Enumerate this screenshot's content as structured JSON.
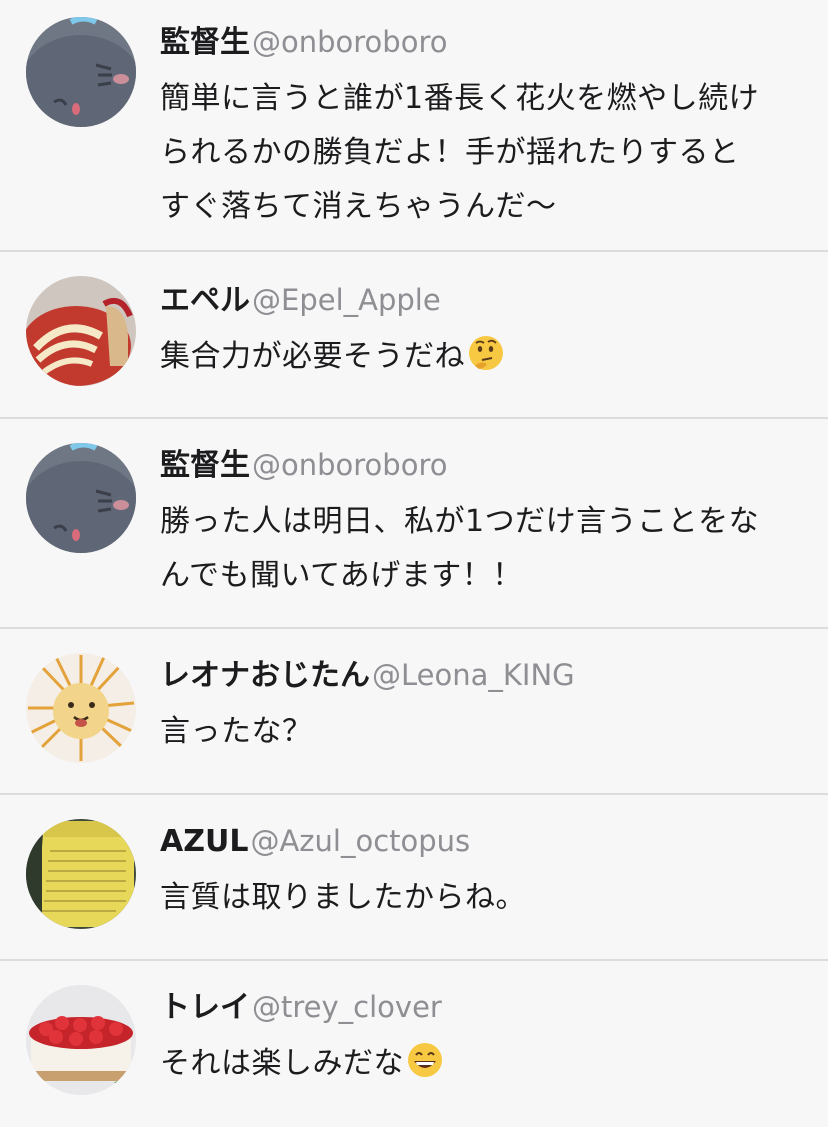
{
  "tweets": [
    {
      "name": "監督生",
      "handle": "@onboroboro",
      "avatar": "ghost-cat-avatar",
      "lines": [
        "簡単に言うと誰が1番長く花火を燃やし続け",
        "られるかの勝負だよ！手が揺れたりすると",
        "すぐ落ちて消えちゃうんだ〜"
      ],
      "emoji": ""
    },
    {
      "name": "エペル",
      "handle": "@Epel_Apple",
      "avatar": "apple-swan-avatar",
      "lines": [
        "集合力が必要そうだね"
      ],
      "emoji": "thinking-face-emoji"
    },
    {
      "name": "監督生",
      "handle": "@onboroboro",
      "avatar": "ghost-cat-avatar",
      "lines": [
        "勝った人は明日、私が1つだけ言うことをな",
        "んでも聞いてあげます！！"
      ],
      "emoji": ""
    },
    {
      "name": "レオナおじたん",
      "handle": "@Leona_KING",
      "avatar": "lion-drawing-avatar",
      "lines": [
        "言ったな？"
      ],
      "emoji": ""
    },
    {
      "name": "AZUL",
      "handle": "@Azul_octopus",
      "avatar": "contract-paper-avatar",
      "lines": [
        "言質は取りましたからね。"
      ],
      "emoji": ""
    },
    {
      "name": "トレイ",
      "handle": "@trey_clover",
      "avatar": "strawberry-cake-avatar",
      "lines": [
        "それは楽しみだな"
      ],
      "emoji": "grinning-face-emoji"
    }
  ],
  "colors": {
    "background": "#f7f7f8",
    "separator": "#dcdcdf",
    "name": "#1c1c1e",
    "handle": "#8e8e93"
  }
}
